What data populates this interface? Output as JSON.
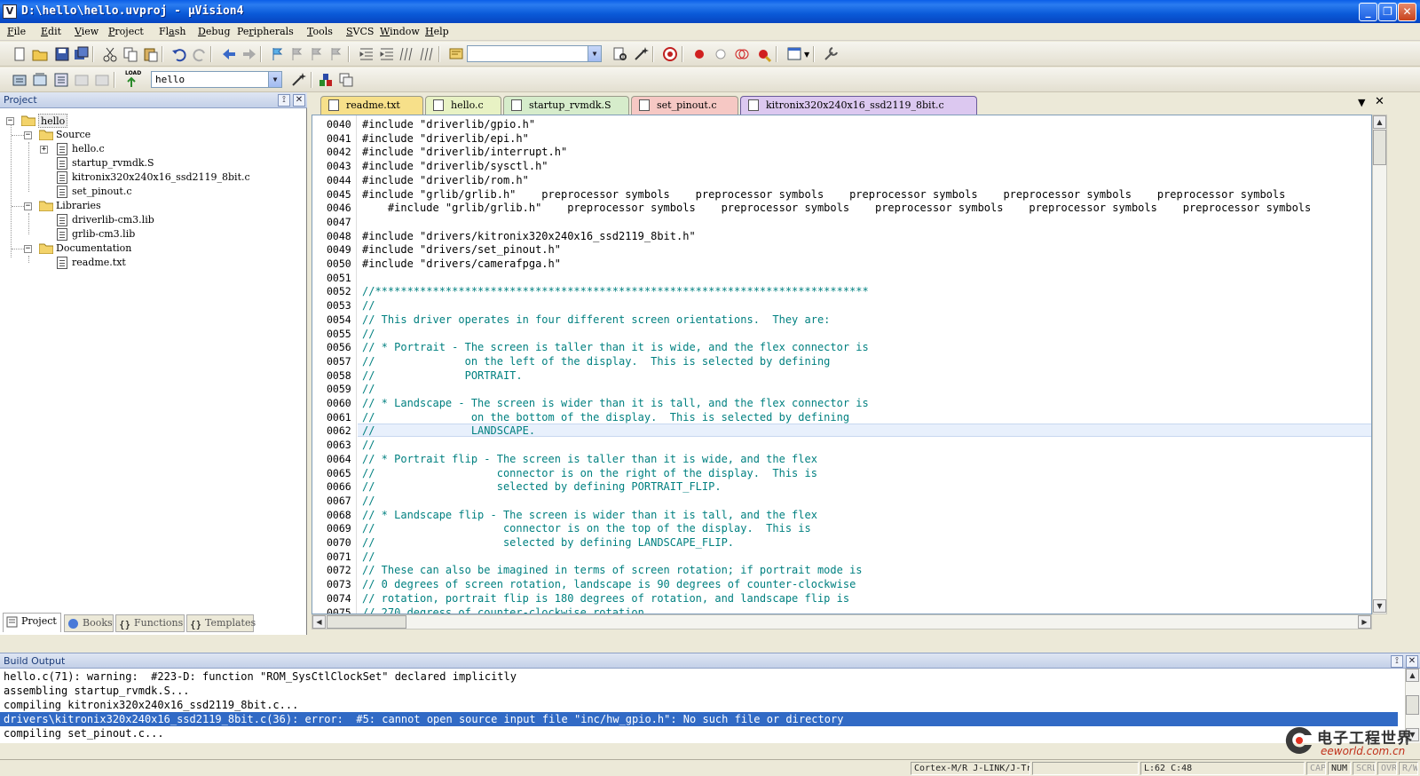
{
  "window": {
    "title": "D:\\hello\\hello.uvproj - µVision4",
    "app_icon": "V"
  },
  "menu": {
    "items": [
      {
        "u": "F",
        "rest": "ile"
      },
      {
        "u": "E",
        "rest": "dit"
      },
      {
        "u": "V",
        "rest": "iew"
      },
      {
        "u": "P",
        "rest": "roject",
        "pre": ""
      },
      {
        "u": "a",
        "rest": "sh",
        "pre": "Fl"
      },
      {
        "u": "D",
        "rest": "ebug"
      },
      {
        "u": "r",
        "rest": "ipherals",
        "pre": "Pe"
      },
      {
        "u": "T",
        "rest": "ools"
      },
      {
        "u": "S",
        "rest": "VCS"
      },
      {
        "u": "W",
        "rest": "indow"
      },
      {
        "u": "H",
        "rest": "elp"
      }
    ]
  },
  "toolbar2": {
    "target_value": "hello",
    "load_label": "LOAD"
  },
  "project": {
    "header": "Project",
    "tree": {
      "root": "hello",
      "groups": [
        {
          "name": "Source",
          "files": [
            "hello.c",
            "startup_rvmdk.S",
            "kitronix320x240x16_ssd2119_8bit.c",
            "set_pinout.c"
          ]
        },
        {
          "name": "Libraries",
          "files": [
            "driverlib-cm3.lib",
            "grlib-cm3.lib"
          ]
        },
        {
          "name": "Documentation",
          "files": [
            "readme.txt"
          ]
        }
      ]
    },
    "bottom_tabs": [
      "Project",
      "Books",
      "Functions",
      "Templates"
    ]
  },
  "editor": {
    "tabs": [
      {
        "label": "readme.txt",
        "color": "#f7e08a"
      },
      {
        "label": "hello.c",
        "color": "#e8f2c4"
      },
      {
        "label": "startup_rvmdk.S",
        "color": "#d6eccb"
      },
      {
        "label": "set_pinout.c",
        "color": "#f6c8c4"
      },
      {
        "label": "kitronix320x240x16_ssd2119_8bit.c",
        "color": "#dcc8f0"
      }
    ],
    "lines": [
      {
        "n": "0040",
        "t": "#include \"driverlib/gpio.h\"",
        "k": "p"
      },
      {
        "n": "0041",
        "t": "#include \"driverlib/epi.h\"",
        "k": "p"
      },
      {
        "n": "0042",
        "t": "#include \"driverlib/interrupt.h\"",
        "k": "p"
      },
      {
        "n": "0043",
        "t": "#include \"driverlib/sysctl.h\"",
        "k": "p"
      },
      {
        "n": "0044",
        "t": "#include \"driverlib/rom.h\"",
        "k": "p"
      },
      {
        "n": "0045",
        "t": "#include \"grlib/grlib.h\"    preprocessor symbols    preprocessor symbols    preprocessor symbols    preprocessor symbols    preprocessor symbols",
        "k": "p"
      },
      {
        "n": "0046",
        "t": "    #include \"grlib/grlib.h\"    preprocessor symbols    preprocessor symbols    preprocessor symbols    preprocessor symbols    preprocessor symbols",
        "k": "p"
      },
      {
        "n": "0047",
        "t": "",
        "k": "p"
      },
      {
        "n": "0048",
        "t": "#include \"drivers/kitronix320x240x16_ssd2119_8bit.h\"",
        "k": "p"
      },
      {
        "n": "0049",
        "t": "#include \"drivers/set_pinout.h\"",
        "k": "p"
      },
      {
        "n": "0050",
        "t": "#include \"drivers/camerafpga.h\"",
        "k": "p"
      },
      {
        "n": "0051",
        "t": "",
        "k": "p"
      },
      {
        "n": "0052",
        "t": "//*****************************************************************************",
        "k": "c"
      },
      {
        "n": "0053",
        "t": "//",
        "k": "c"
      },
      {
        "n": "0054",
        "t": "// This driver operates in four different screen orientations.  They are:",
        "k": "c"
      },
      {
        "n": "0055",
        "t": "//",
        "k": "c"
      },
      {
        "n": "0056",
        "t": "// * Portrait - The screen is taller than it is wide, and the flex connector is",
        "k": "c"
      },
      {
        "n": "0057",
        "t": "//              on the left of the display.  This is selected by defining",
        "k": "c"
      },
      {
        "n": "0058",
        "t": "//              PORTRAIT.",
        "k": "c"
      },
      {
        "n": "0059",
        "t": "//",
        "k": "c"
      },
      {
        "n": "0060",
        "t": "// * Landscape - The screen is wider than it is tall, and the flex connector is",
        "k": "c"
      },
      {
        "n": "0061",
        "t": "//               on the bottom of the display.  This is selected by defining",
        "k": "c"
      },
      {
        "n": "0062",
        "t": "//               LANDSCAPE.",
        "k": "c"
      },
      {
        "n": "0063",
        "t": "//",
        "k": "c"
      },
      {
        "n": "0064",
        "t": "// * Portrait flip - The screen is taller than it is wide, and the flex",
        "k": "c"
      },
      {
        "n": "0065",
        "t": "//                   connector is on the right of the display.  This is",
        "k": "c"
      },
      {
        "n": "0066",
        "t": "//                   selected by defining PORTRAIT_FLIP.",
        "k": "c"
      },
      {
        "n": "0067",
        "t": "//",
        "k": "c"
      },
      {
        "n": "0068",
        "t": "// * Landscape flip - The screen is wider than it is tall, and the flex",
        "k": "c"
      },
      {
        "n": "0069",
        "t": "//                    connector is on the top of the display.  This is",
        "k": "c"
      },
      {
        "n": "0070",
        "t": "//                    selected by defining LANDSCAPE_FLIP.",
        "k": "c"
      },
      {
        "n": "0071",
        "t": "//",
        "k": "c"
      },
      {
        "n": "0072",
        "t": "// These can also be imagined in terms of screen rotation; if portrait mode is",
        "k": "c"
      },
      {
        "n": "0073",
        "t": "// 0 degrees of screen rotation, landscape is 90 degrees of counter-clockwise",
        "k": "c"
      },
      {
        "n": "0074",
        "t": "// rotation, portrait flip is 180 degrees of rotation, and landscape flip is",
        "k": "c"
      },
      {
        "n": "0075",
        "t": "// 270 degress of counter-clockwise rotation.",
        "k": "c"
      }
    ]
  },
  "build": {
    "header": "Build Output",
    "lines": [
      {
        "t": "hello.c(71): warning:  #223-D: function \"ROM_SysCtlClockSet\" declared implicitly",
        "err": false
      },
      {
        "t": "assembling startup_rvmdk.S...",
        "err": false
      },
      {
        "t": "compiling kitronix320x240x16_ssd2119_8bit.c...",
        "err": false
      },
      {
        "t": "drivers\\kitronix320x240x16_ssd2119_8bit.c(36): error:  #5: cannot open source input file \"inc/hw_gpio.h\": No such file or directory",
        "err": true
      },
      {
        "t": "compiling set_pinout.c...",
        "err": false
      }
    ]
  },
  "status": {
    "debugger": "Cortex-M/R J-LINK/J-Tr",
    "position": "L:62 C:48",
    "cap": "CAP",
    "num": "NUM",
    "scrl": "SCRL",
    "ovr": "OVR",
    "rw": "R/W"
  },
  "watermark": {
    "cn": "电子工程世界",
    "url": "eeworld.com.cn"
  },
  "colors": {
    "title_bar": "#0a5ad8",
    "selection": "#316ac5",
    "comment": "#008080"
  }
}
